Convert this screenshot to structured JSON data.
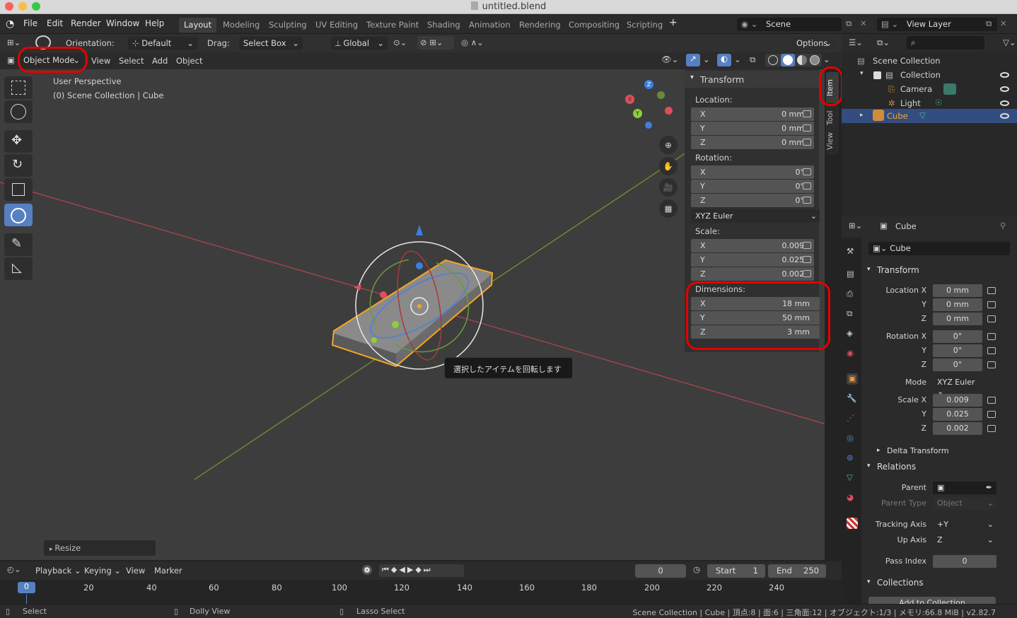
{
  "window": {
    "title": "untitled.blend"
  },
  "menus": [
    "File",
    "Edit",
    "Render",
    "Window",
    "Help"
  ],
  "workspaces": [
    "Layout",
    "Modeling",
    "Sculpting",
    "UV Editing",
    "Texture Paint",
    "Shading",
    "Animation",
    "Rendering",
    "Compositing",
    "Scripting"
  ],
  "active_workspace": "Layout",
  "scene": {
    "name": "Scene",
    "view_layer": "View Layer"
  },
  "tool_header": {
    "orientation_label": "Orientation:",
    "orientation_value": "Default",
    "drag_label": "Drag:",
    "drag_value": "Select Box",
    "transform_orientation": "Global",
    "options": "Options"
  },
  "viewport_header": {
    "mode": "Object Mode",
    "menus": [
      "View",
      "Select",
      "Add",
      "Object"
    ]
  },
  "viewport": {
    "perspective": "User Perspective",
    "collection_info": "(0) Scene Collection | Cube",
    "tooltip": "選択したアイテムを回転します",
    "last_op": "Resize",
    "gizmo_axes": [
      "X",
      "Y",
      "Z"
    ]
  },
  "npanel": {
    "tabs": [
      "Item",
      "Tool",
      "View"
    ],
    "section": "Transform",
    "location_label": "Location:",
    "location": [
      {
        "axis": "X",
        "value": "0 mm"
      },
      {
        "axis": "Y",
        "value": "0 mm"
      },
      {
        "axis": "Z",
        "value": "0 mm"
      }
    ],
    "rotation_label": "Rotation:",
    "rotation": [
      {
        "axis": "X",
        "value": "0°"
      },
      {
        "axis": "Y",
        "value": "0°"
      },
      {
        "axis": "Z",
        "value": "0°"
      }
    ],
    "rotation_mode": "XYZ Euler",
    "scale_label": "Scale:",
    "scale": [
      {
        "axis": "X",
        "value": "0.009"
      },
      {
        "axis": "Y",
        "value": "0.025"
      },
      {
        "axis": "Z",
        "value": "0.002"
      }
    ],
    "dimensions_label": "Dimensions:",
    "dimensions": [
      {
        "axis": "X",
        "value": "18 mm"
      },
      {
        "axis": "Y",
        "value": "50 mm"
      },
      {
        "axis": "Z",
        "value": "3 mm"
      }
    ]
  },
  "outliner": {
    "root": "Scene Collection",
    "items": [
      {
        "name": "Collection"
      },
      {
        "name": "Camera"
      },
      {
        "name": "Light"
      },
      {
        "name": "Cube",
        "selected": true
      }
    ]
  },
  "properties": {
    "object_name": "Cube",
    "object_field": "Cube",
    "transform_section": "Transform",
    "location_labels": [
      "Location X",
      "Y",
      "Z"
    ],
    "location_values": [
      "0 mm",
      "0 mm",
      "0 mm"
    ],
    "rotation_labels": [
      "Rotation X",
      "Y",
      "Z"
    ],
    "rotation_values": [
      "0°",
      "0°",
      "0°"
    ],
    "mode_label": "Mode",
    "mode_value": "XYZ Euler",
    "scale_labels": [
      "Scale X",
      "Y",
      "Z"
    ],
    "scale_values": [
      "0.009",
      "0.025",
      "0.002"
    ],
    "delta_transform": "Delta Transform",
    "relations_section": "Relations",
    "parent_label": "Parent",
    "parent_type_label": "Parent Type",
    "parent_type_value": "Object",
    "tracking_axis_label": "Tracking Axis",
    "tracking_axis_value": "+Y",
    "up_axis_label": "Up Axis",
    "up_axis_value": "Z",
    "pass_index_label": "Pass Index",
    "pass_index_value": "0",
    "collections_section": "Collections",
    "add_to_collection": "Add to Collection"
  },
  "timeline": {
    "menus": [
      "Playback",
      "Keying",
      "View",
      "Marker"
    ],
    "current_frame": "0",
    "start_label": "Start",
    "start_value": "1",
    "end_label": "End",
    "end_value": "250",
    "ruler": [
      "0",
      "20",
      "40",
      "60",
      "80",
      "100",
      "120",
      "140",
      "160",
      "180",
      "200",
      "220",
      "240"
    ]
  },
  "statusbar": {
    "select": "Select",
    "dolly": "Dolly View",
    "lasso": "Lasso Select",
    "info": "Scene Collection | Cube | 頂点:8 | 面:6 | 三角面:12 | オブジェクト:1/3 | メモリ:66.8 MiB | v2.82.7"
  },
  "colors": {
    "accent": "#5680c2",
    "selection": "#f5a623",
    "highlight_ring": "#e40000"
  }
}
